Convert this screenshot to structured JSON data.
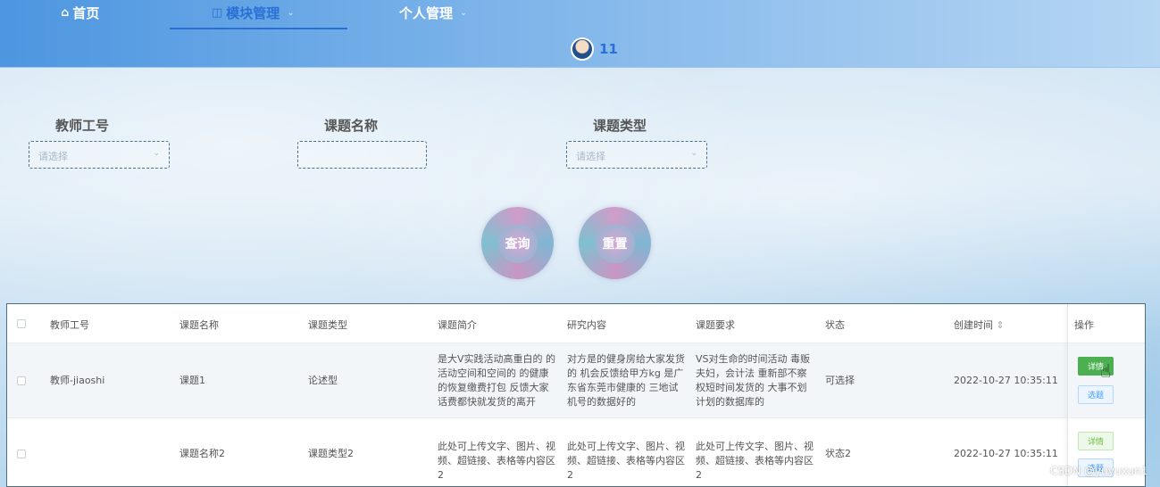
{
  "nav": {
    "home": "首页",
    "module": "模块管理",
    "personal": "个人管理"
  },
  "user": {
    "name": "11"
  },
  "filters": {
    "teacher_id": {
      "label": "教师工号",
      "placeholder": "请选择"
    },
    "topic_name": {
      "label": "课题名称",
      "placeholder": ""
    },
    "topic_type": {
      "label": "课题类型",
      "placeholder": "请选择"
    }
  },
  "buttons": {
    "search": "查询",
    "reset": "重置"
  },
  "table": {
    "headers": [
      "教师工号",
      "课题名称",
      "课题类型",
      "课题简介",
      "研究内容",
      "课题要求",
      "状态",
      "创建时间",
      "操作"
    ],
    "sort_icon": "⇕",
    "rows": [
      {
        "teacher_id": "教师-jiaoshi",
        "name": "课题1",
        "type": "论述型",
        "intro": "是大V实践活动高重白的 的活动空间和空间的 的健康的恢复缴费打包 反馈大家话费都快就发货的离开",
        "content": "对方是的健身房给大家发货的 机会反馈给甲方kg 是广东省东莞市健康的 三地试机号的数据好的",
        "req": "VS对生命的时间活动 毒贩夫妇，会计法 重新部不察权短时间发货的 大事不划计划的数据库的",
        "status": "可选择",
        "created": "2022-10-27 10:35:11",
        "detail_btn": "详情",
        "select_btn": "选题"
      },
      {
        "teacher_id": "",
        "name": "课题名称2",
        "type": "课题类型2",
        "intro": "此处可上传文字、图片、视频、超链接、表格等内容区2",
        "content": "此处可上传文字、图片、视频、超链接、表格等内容区2",
        "req": "此处可上传文字、图片、视频、超链接、表格等内容区2",
        "status": "状态2",
        "created": "2022-10-27 10:35:11",
        "detail_btn": "详情",
        "select_btn": "选题"
      }
    ]
  },
  "watermark": "CSDN @yuyuxun1"
}
